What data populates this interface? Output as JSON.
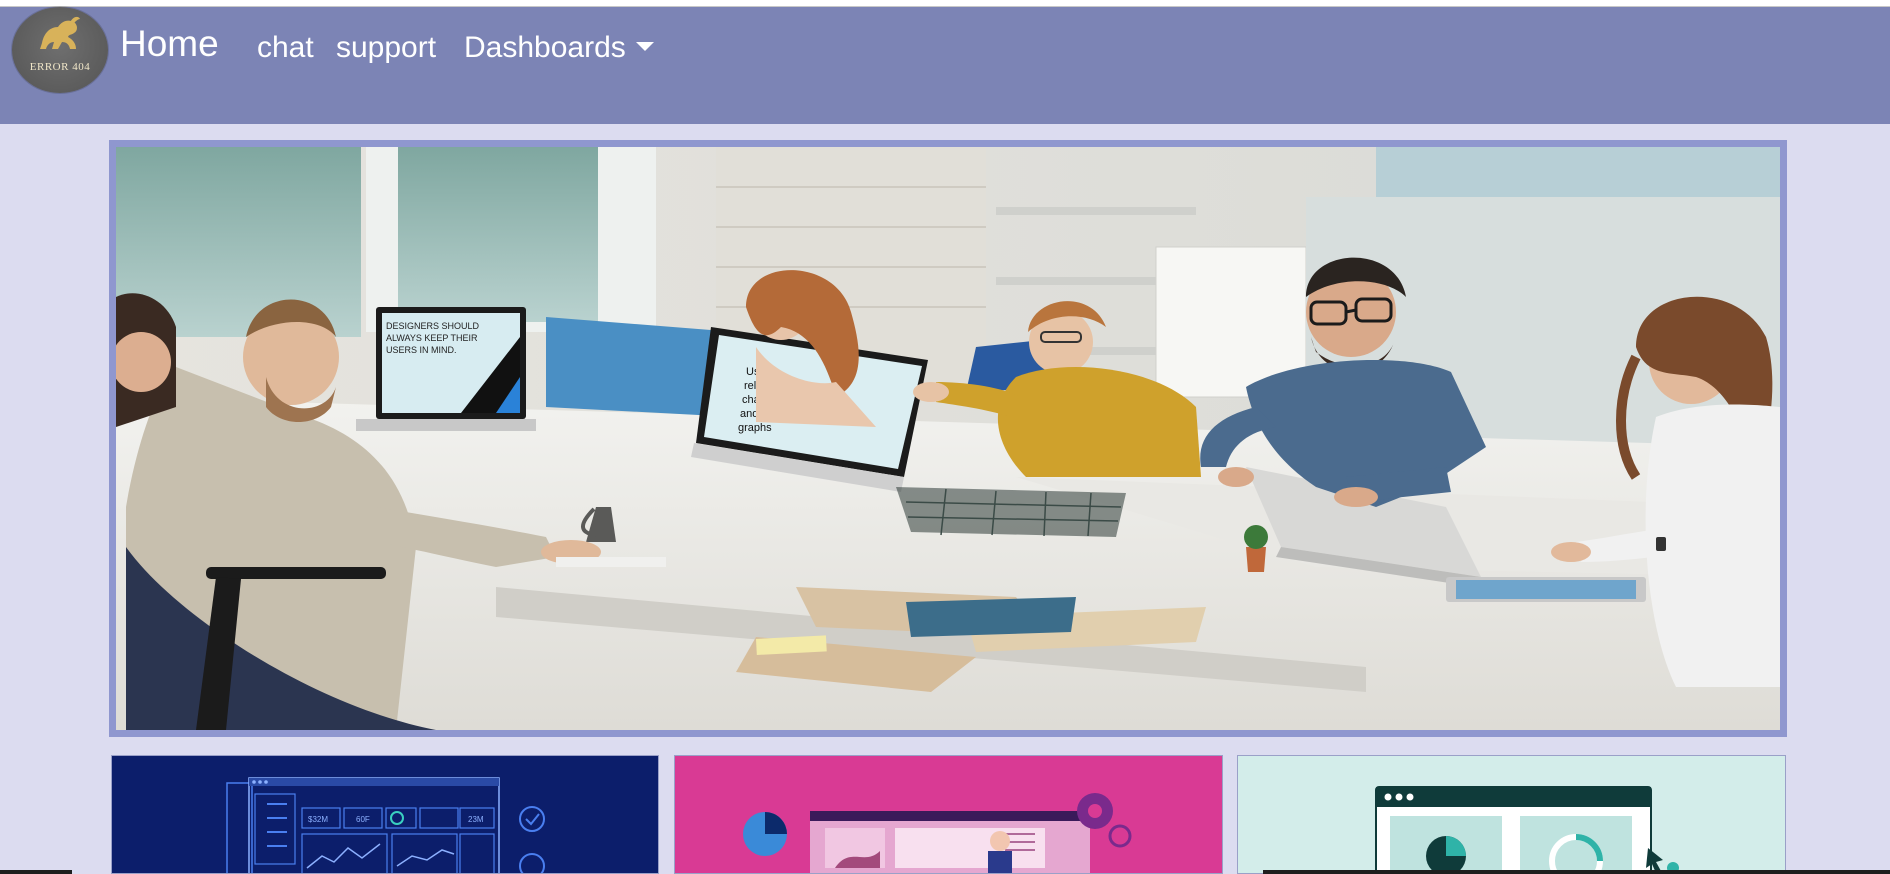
{
  "navbar": {
    "logo_text": "ERROR 404",
    "home": "Home",
    "links": [
      "chat",
      "support"
    ],
    "dashboards": "Dashboards"
  },
  "hero": {
    "monitor1_text": "DESIGNERS SHOULD ALWAYS KEEP THEIR USERS IN MIND.",
    "monitor2_text": [
      "Use",
      "relevant",
      "charts",
      "and",
      "graphs"
    ]
  },
  "cards": {
    "card1_metrics": [
      "$32M",
      "60F",
      "23M"
    ]
  },
  "colors": {
    "navbar": "#7c84b5",
    "page_bg": "#dcdcf0",
    "hero_border": "#8f97cf",
    "card1": "#0c1e6b",
    "card2": "#d93a94",
    "card3": "#d3edea"
  }
}
